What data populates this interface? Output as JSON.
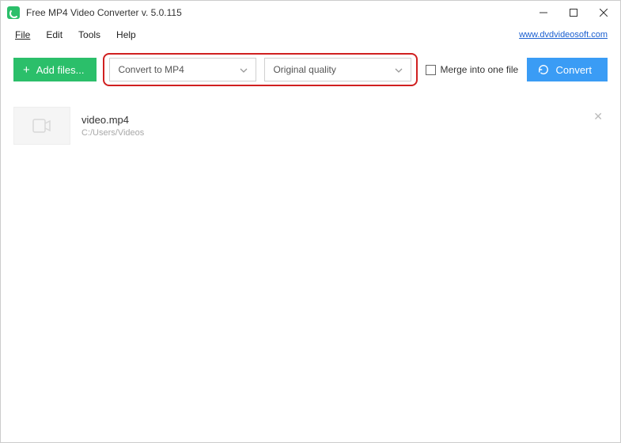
{
  "window": {
    "title": "Free MP4 Video Converter v. 5.0.115"
  },
  "menu": {
    "file": "File",
    "edit": "Edit",
    "tools": "Tools",
    "help": "Help",
    "link": "www.dvdvideosoft.com"
  },
  "toolbar": {
    "add_files": "Add files...",
    "format_select": "Convert to MP4",
    "quality_select": "Original quality",
    "merge_label": "Merge into one file",
    "convert": "Convert"
  },
  "file": {
    "name": "video.mp4",
    "path": "C:/Users/Videos"
  }
}
